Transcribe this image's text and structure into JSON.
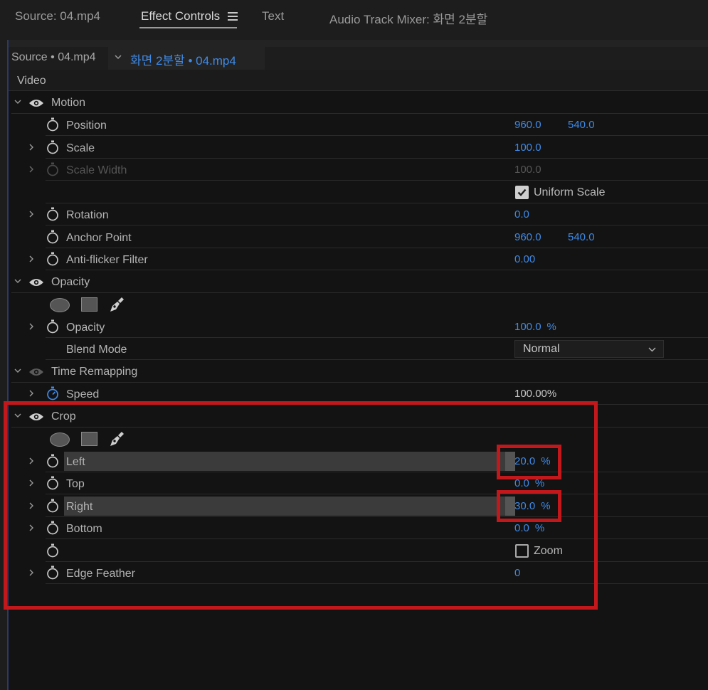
{
  "tabs": [
    {
      "label": "Source: 04.mp4",
      "active": false
    },
    {
      "label": "Effect Controls",
      "active": true
    },
    {
      "label": "Text",
      "active": false
    },
    {
      "label": "Audio Track Mixer: 화면 2분할",
      "active": false
    }
  ],
  "panel": {
    "source_label": "Source • 04.mp4",
    "clip_label": "화면 2분할 • 04.mp4",
    "video_header": "Video"
  },
  "motion": {
    "title": "Motion",
    "position": {
      "label": "Position",
      "x": "960.0",
      "y": "540.0"
    },
    "scale": {
      "label": "Scale",
      "value": "100.0"
    },
    "scale_width": {
      "label": "Scale Width",
      "value": "100.0"
    },
    "uniform_scale": {
      "label": "Uniform Scale",
      "checked": true
    },
    "rotation": {
      "label": "Rotation",
      "value": "0.0"
    },
    "anchor_point": {
      "label": "Anchor Point",
      "x": "960.0",
      "y": "540.0"
    },
    "anti_flicker": {
      "label": "Anti-flicker Filter",
      "value": "0.00"
    }
  },
  "opacity": {
    "title": "Opacity",
    "opacity": {
      "label": "Opacity",
      "value": "100.0",
      "unit": "%"
    },
    "blend_mode": {
      "label": "Blend Mode",
      "value": "Normal"
    }
  },
  "time_remapping": {
    "title": "Time Remapping",
    "speed": {
      "label": "Speed",
      "value": "100.00%"
    }
  },
  "crop": {
    "title": "Crop",
    "left": {
      "label": "Left",
      "value": "20.0",
      "unit": "%"
    },
    "top": {
      "label": "Top",
      "value": "0.0",
      "unit": "%"
    },
    "right": {
      "label": "Right",
      "value": "30.0",
      "unit": "%"
    },
    "bottom": {
      "label": "Bottom",
      "value": "0.0",
      "unit": "%"
    },
    "zoom": {
      "label": "Zoom",
      "checked": false
    },
    "edge_feather": {
      "label": "Edge Feather",
      "value": "0"
    }
  },
  "colors": {
    "value_blue": "#3f8ae8",
    "annotation_red": "#c2181c",
    "panel_bg": "#131313"
  }
}
